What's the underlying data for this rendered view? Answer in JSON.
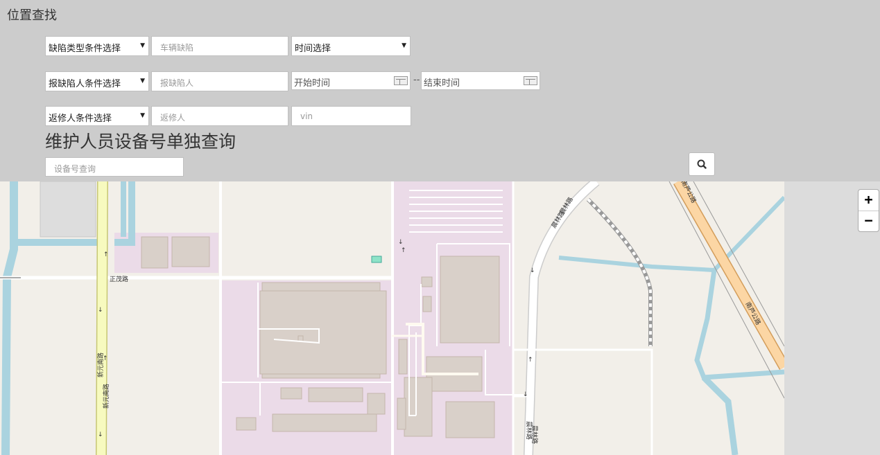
{
  "panel": {
    "title": "位置查找",
    "row1": {
      "defect_type_select": "缺陷类型条件选择",
      "vehicle_defect_placeholder": "车辆缺陷",
      "time_select": "时间选择"
    },
    "row2": {
      "reporter_select": "报缺陷人条件选择",
      "reporter_placeholder": "报缺陷人",
      "start_time_placeholder": "开始时间",
      "range_separator": "--",
      "end_time_placeholder": "结束时间"
    },
    "row3": {
      "repairer_select": "返修人条件选择",
      "repairer_placeholder": "返修人",
      "vin_placeholder": "vin"
    },
    "device_section": {
      "title": "维护人员设备号单独查询",
      "device_placeholder": "设备号查询"
    },
    "icons": {
      "search": "search-icon",
      "calendar": "calendar-icon",
      "dropdown": "caret-down-icon"
    }
  },
  "map": {
    "road_labels": {
      "zhengmao": "正茂路",
      "xinyuan_south_1": "新元南路",
      "xinyuan_south_2": "新元南路",
      "chenglin_1": "晨林路",
      "chenglin_2": "晨林路",
      "chenglin_3": "晨林路",
      "chenglin_4": "晨林路",
      "nanlu_highway_1": "南芦公路",
      "nanlu_highway_2": "南芦公路"
    },
    "zoom_in": "+",
    "zoom_out": "−"
  }
}
